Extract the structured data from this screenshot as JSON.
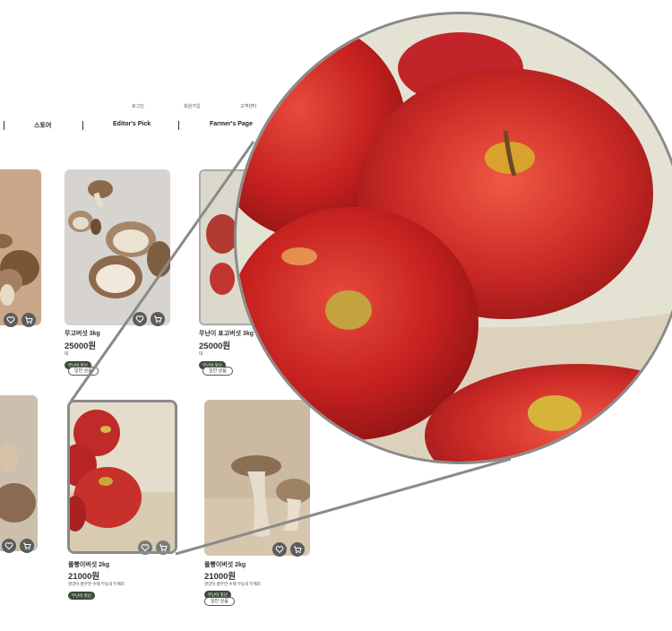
{
  "top_links": [
    "로그인",
    "회원가입",
    "고객센터"
  ],
  "nav": {
    "items": [
      "스토어",
      "Editor's Pick",
      "Farmer's Page"
    ]
  },
  "products_row1": [
    {
      "name": "",
      "price": ""
    },
    {
      "name": "무고버섯 3kg",
      "price": "25000원",
      "desc": "대",
      "badge": "무난이 못난",
      "tag": "일반 상품"
    },
    {
      "name": "무난이 표고버섯 3kg",
      "price": "25000원",
      "desc": "대",
      "badge": "무난이 못난",
      "tag": "일반 상품"
    }
  ],
  "products_row2": [
    {
      "name": "",
      "price": ""
    },
    {
      "name": "풀빵이버섯 2kg",
      "price": "21000원",
      "desc": "영양이 풍부한 수제 무농약 두께조",
      "badge": "무난이 못난",
      "tag": ""
    },
    {
      "name": "풀빵이버섯 2kg",
      "price": "21000원",
      "desc": "영양이 풍부한 수제 무농약 두께조",
      "badge": "무난이 못난",
      "tag": "일반 상품"
    }
  ],
  "icons": {
    "wish": "heart-icon",
    "cart": "cart-icon"
  },
  "colors": {
    "accent_dark": "#3e4a3a",
    "button_gray": "#5c5c5c",
    "frame_gray": "#8a8a8a",
    "apple_red": "#c82a2a"
  }
}
